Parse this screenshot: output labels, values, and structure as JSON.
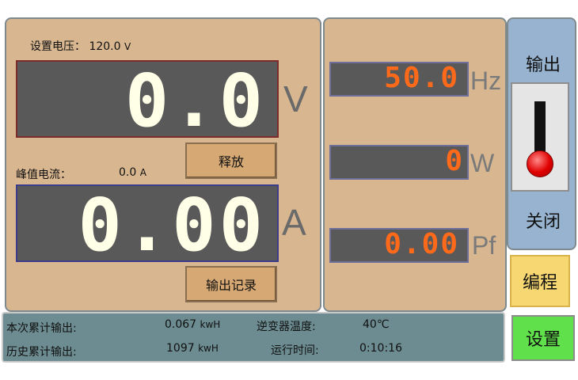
{
  "voltage": {
    "setpoint_label": "设置电压：",
    "setpoint_value": "120.0",
    "setpoint_unit": "V",
    "reading": "0.0",
    "unit": "V"
  },
  "current": {
    "peak_label": "峰值电流：",
    "peak_value": "0.0",
    "peak_unit": "A",
    "reading": "0.00",
    "unit": "A"
  },
  "buttons": {
    "release": "释放",
    "output_log": "输出记录"
  },
  "meters": {
    "frequency": {
      "value": "50.0",
      "unit": "Hz"
    },
    "power": {
      "value": "0",
      "unit": "W"
    },
    "power_factor": {
      "value": "0.00",
      "unit": "Pf"
    }
  },
  "side": {
    "output_label": "输出",
    "toggle_state": "关闭",
    "program_button": "编程",
    "settings_button": "设置"
  },
  "stats": {
    "current_output_label": "本次累计输出:",
    "current_output_value": "0.067",
    "current_output_unit": "kwH",
    "history_output_label": "历史累计输出:",
    "history_output_value": "1097",
    "history_output_unit": "kwH",
    "inverter_temp_label": "逆变器温度:",
    "inverter_temp_value": "40",
    "inverter_temp_unit": "℃",
    "runtime_label": "运行时间:",
    "runtime_value": "0:10:16"
  },
  "colors": {
    "panel_bg": "#d8b690",
    "display_bg": "#595959",
    "segment_white": "#ffffe8",
    "segment_orange": "#ff6a1a",
    "side_panel_bg": "#97b3cf",
    "program_button_bg": "#f7d772",
    "settings_button_bg": "#60e04a",
    "status_bar_bg": "#6c8c91"
  }
}
